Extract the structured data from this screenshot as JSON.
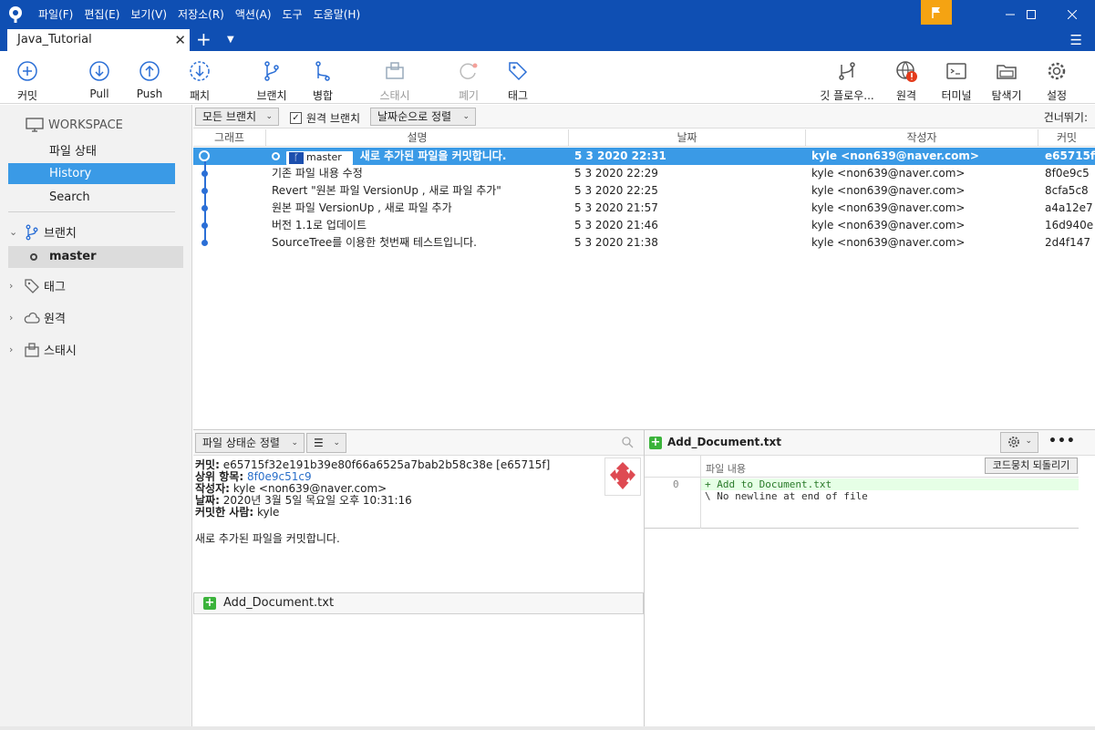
{
  "menu": [
    "파일(F)",
    "편집(E)",
    "보기(V)",
    "저장소(R)",
    "액션(A)",
    "도구",
    "도움말(H)"
  ],
  "tab": {
    "title": "Java_Tutorial"
  },
  "toolbar": {
    "commit": "커밋",
    "pull": "Pull",
    "push": "Push",
    "fetch": "패치",
    "branch": "브랜치",
    "merge": "병합",
    "stash": "스태시",
    "discard": "폐기",
    "tag": "태그",
    "gitflow": "깃 플로우...",
    "remote": "원격",
    "terminal": "터미널",
    "explorer": "탐색기",
    "settings": "설정"
  },
  "sidebar": {
    "workspace": "WORKSPACE",
    "file_status": "파일 상태",
    "history": "History",
    "search": "Search",
    "branches": "브랜치",
    "master": "master",
    "tags": "태그",
    "remotes": "원격",
    "stashes": "스태시"
  },
  "filters": {
    "branches": "모든 브랜치",
    "remote_branches": "원격 브랜치",
    "sort": "날짜순으로 정렬",
    "skip": "건너뛰기:"
  },
  "columns": {
    "graph": "그래프",
    "desc": "설명",
    "date": "날짜",
    "author": "작성자",
    "commit": "커밋"
  },
  "commits": [
    {
      "desc": "새로 추가된 파일을 커밋합니다.",
      "date": "5 3 2020 22:31",
      "author": "kyle <non639@naver.com>",
      "hash": "e65715f",
      "branch": "master"
    },
    {
      "desc": "기존 파일 내용 수정",
      "date": "5 3 2020 22:29",
      "author": "kyle <non639@naver.com>",
      "hash": "8f0e9c5"
    },
    {
      "desc": "Revert \"원본 파일 VersionUp , 새로 파일 추가\"",
      "date": "5 3 2020 22:25",
      "author": "kyle <non639@naver.com>",
      "hash": "8cfa5c8"
    },
    {
      "desc": "원본 파일 VersionUp , 새로 파일 추가",
      "date": "5 3 2020 21:57",
      "author": "kyle <non639@naver.com>",
      "hash": "a4a12e7"
    },
    {
      "desc": "버전 1.1로 업데이트",
      "date": "5 3 2020 21:46",
      "author": "kyle <non639@naver.com>",
      "hash": "16d940e"
    },
    {
      "desc": "SourceTree를 이용한 첫번째 테스트입니다.",
      "date": "5 3 2020 21:38",
      "author": "kyle <non639@naver.com>",
      "hash": "2d4f147"
    }
  ],
  "details": {
    "sort": "파일 상태순 정렬",
    "commit_label": "커밋:",
    "commit_value": "e65715f32e191b39e80f66a6525a7bab2b58c38e [e65715f]",
    "parent_label": "상위 항목:",
    "parent_value": "8f0e9c51c9",
    "author_label": "작성자:",
    "author_value": "kyle <non639@naver.com>",
    "date_label": "날짜:",
    "date_value": "2020년 3월 5일 목요일 오후 10:31:16",
    "committer_label": "커밋한 사람:",
    "committer_value": "kyle",
    "message": "새로 추가된 파일을 커밋합니다.",
    "file": "Add_Document.txt"
  },
  "diff": {
    "file": "Add_Document.txt",
    "header": "파일 내용",
    "revert": "코드뭉치 되돌리기",
    "line_no": "0",
    "added": "+ Add to Document.txt",
    "note": "\\  No newline at end of file"
  },
  "colors": {
    "titlebar": "#0f4fb3",
    "selection": "#3a9ae6",
    "graph": "#2b6fd6",
    "flag": "#f5a312",
    "added": "#e6ffe6"
  }
}
